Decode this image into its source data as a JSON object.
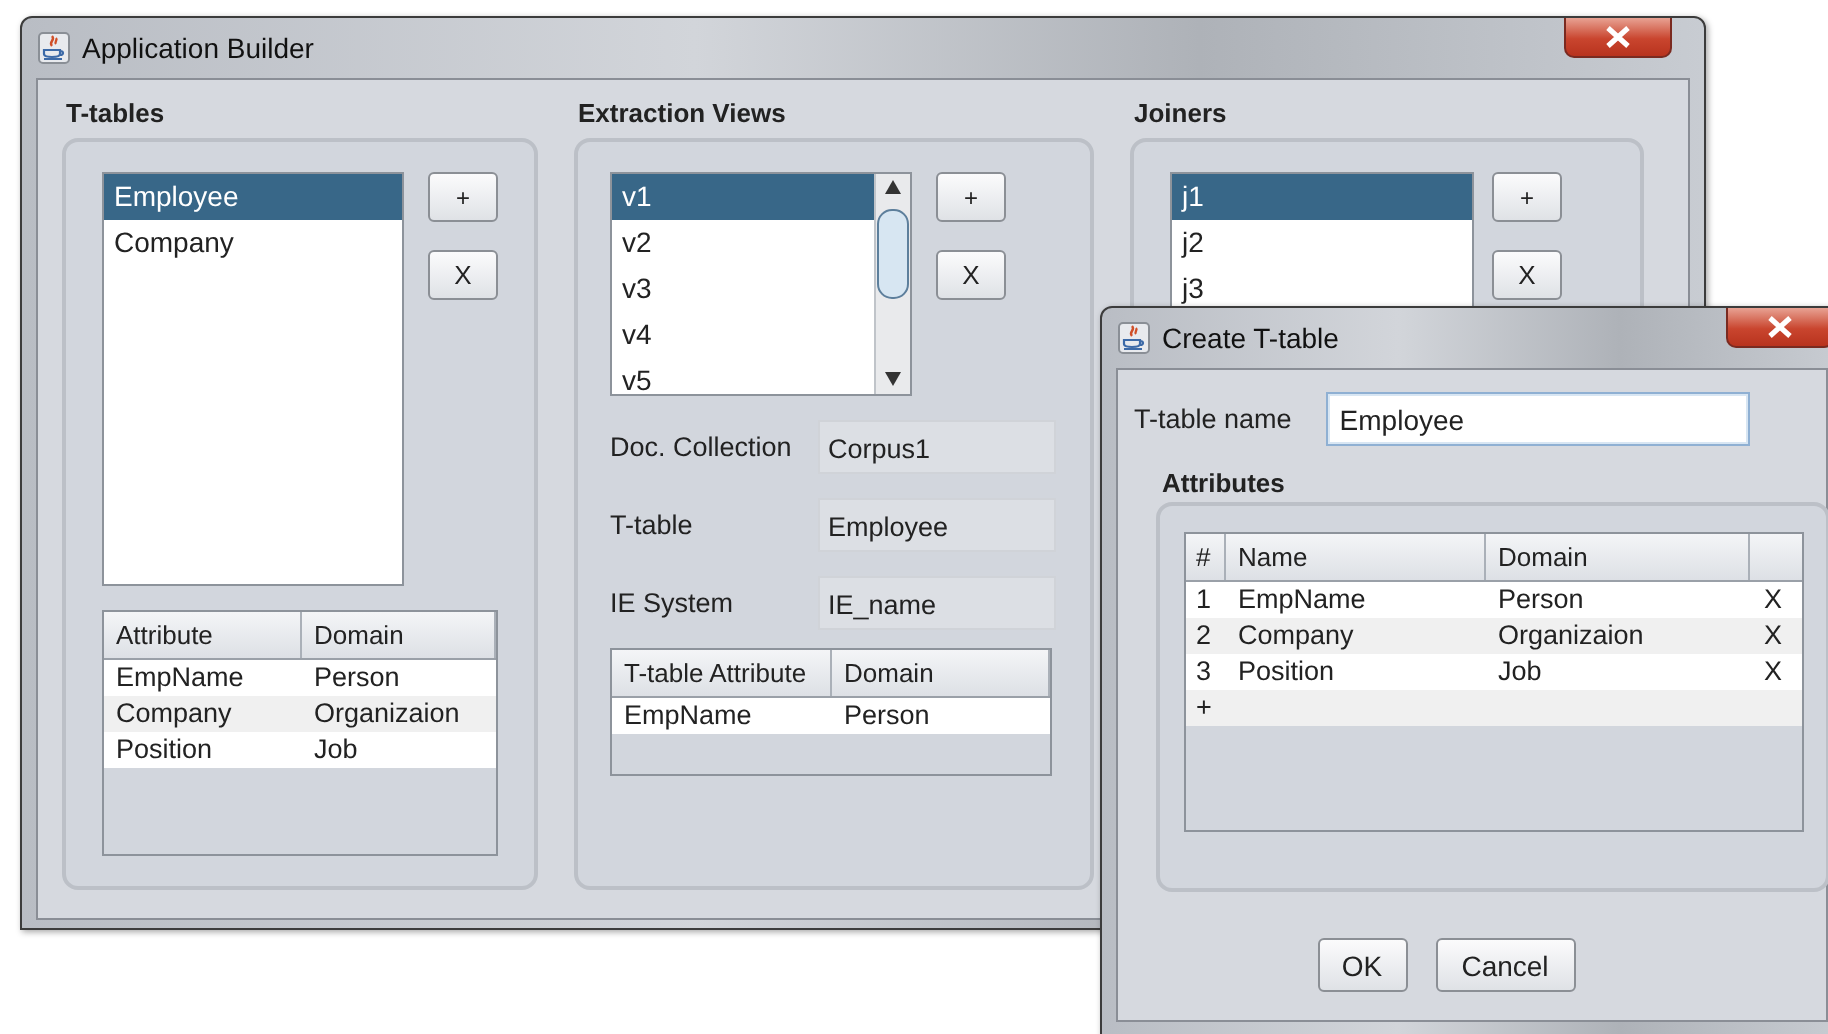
{
  "main_window": {
    "title": "Application Builder"
  },
  "t_tables": {
    "title": "T-tables",
    "items": [
      {
        "label": "Employee",
        "selected": true
      },
      {
        "label": "Company",
        "selected": false
      }
    ],
    "add_button": "+",
    "remove_button": "X",
    "table": {
      "columns": [
        "Attribute",
        "Domain"
      ],
      "rows": [
        [
          "EmpName",
          "Person"
        ],
        [
          "Company",
          "Organizaion"
        ],
        [
          "Position",
          "Job"
        ]
      ]
    }
  },
  "extraction_views": {
    "title": "Extraction Views",
    "items": [
      {
        "label": "v1",
        "selected": true
      },
      {
        "label": "v2",
        "selected": false
      },
      {
        "label": "v3",
        "selected": false
      },
      {
        "label": "v4",
        "selected": false
      },
      {
        "label": "v5",
        "selected": false
      }
    ],
    "add_button": "+",
    "remove_button": "X",
    "fields": [
      {
        "label": "Doc. Collection",
        "value": "Corpus1"
      },
      {
        "label": "T-table",
        "value": "Employee"
      },
      {
        "label": "IE System",
        "value": "IE_name"
      }
    ],
    "table": {
      "columns": [
        "T-table Attribute",
        "Domain"
      ],
      "rows": [
        [
          "EmpName",
          "Person"
        ]
      ]
    }
  },
  "joiners": {
    "title": "Joiners",
    "items": [
      {
        "label": "j1",
        "selected": true
      },
      {
        "label": "j2",
        "selected": false
      },
      {
        "label": "j3",
        "selected": false
      }
    ],
    "add_button": "+",
    "remove_button": "X"
  },
  "dialog": {
    "title": "Create T-table",
    "name_label": "T-table name",
    "name_value": "Employee",
    "attributes_title": "Attributes",
    "table": {
      "columns": [
        "#",
        "Name",
        "Domain"
      ],
      "rows": [
        {
          "index": "1",
          "name": "EmpName",
          "domain": "Person",
          "remove": "X"
        },
        {
          "index": "2",
          "name": "Company",
          "domain": "Organizaion",
          "remove": "X"
        },
        {
          "index": "3",
          "name": "Position",
          "domain": "Job",
          "remove": "X"
        }
      ],
      "add_row": "+"
    },
    "buttons": [
      "OK",
      "Cancel"
    ]
  }
}
